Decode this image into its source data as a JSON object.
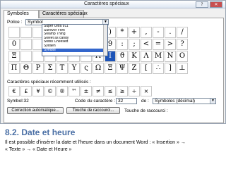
{
  "dialog": {
    "title": "Caractères spéciaux",
    "help_glyph": "?",
    "close_glyph": "✕",
    "tabs": [
      {
        "label": "Symboles",
        "active": true
      },
      {
        "label": "Caractères spéciaux",
        "active": false
      }
    ],
    "font_label": "Police :",
    "font_value": "Symbol",
    "font_options": [
      "Super Ultra 911",
      "Survivor Font",
      "Swamp Thing",
      "Sweet as candy",
      "Swiss Cheesed",
      "Sylfaen",
      "Symbol"
    ],
    "grid_symbols": [
      [
        "",
        "",
        "",
        "",
        "",
        "",
        "",
        "(",
        ")",
        "*",
        "+",
        ",",
        "-",
        ".",
        "/"
      ],
      [
        "0",
        "",
        "",
        "",
        "",
        "",
        "",
        "8",
        "9",
        ":",
        ";",
        "<",
        "=",
        ">",
        "?"
      ],
      [
        "Ξ",
        "",
        "",
        "",
        "",
        "",
        "",
        "Η",
        "Ι",
        "ϑ",
        "Κ",
        "Λ",
        "Μ",
        "Ν",
        "Ο"
      ],
      [
        "Π",
        "Θ",
        "Ρ",
        "Σ",
        "Τ",
        "Υ",
        "ς",
        "Ω",
        "Ξ",
        "Ψ",
        "Ζ",
        "[",
        "∴",
        "]",
        "⊥"
      ]
    ],
    "selected_cell": "Ι",
    "recent_label": "Caractères spéciaux récemment utilisés :",
    "recent_symbols": [
      "€",
      "£",
      "¥",
      "©",
      "®",
      "™",
      "±",
      "≠",
      "≤",
      "≥",
      "÷",
      "×"
    ],
    "symbol_name": "Symbol:32",
    "char_code_label": "Code du caractère :",
    "char_code_value": "32",
    "from_label": "de :",
    "from_value": "Symboles (décimal)",
    "autocorrect_button": "Correction automatique...",
    "shortcut_button": "Touche de raccourci...",
    "shortcut_label": "Touche de raccourci :"
  },
  "document": {
    "heading": "8.2. Date et heure",
    "paragraph_line1": "Il est possible d'insérer la date et l'heure dans un document Word : « Insertion » ",
    "arrow1": "→",
    "paragraph_line2_a": "« Texte » ",
    "arrow2": "→",
    "paragraph_line2_b": " « Date et Heure »"
  }
}
